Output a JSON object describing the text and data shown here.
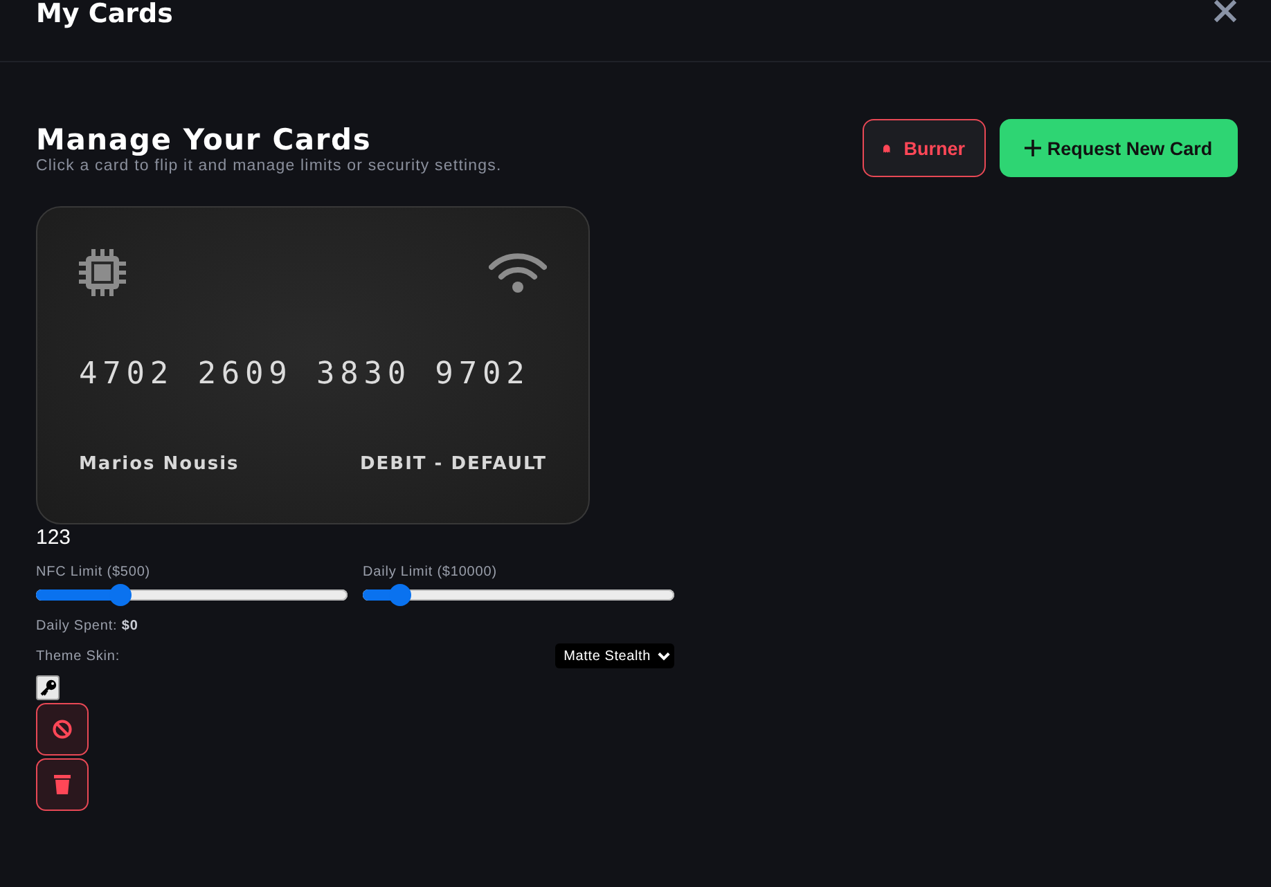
{
  "header": {
    "title": "My Cards"
  },
  "page": {
    "title": "Manage Your Cards",
    "subtitle": "Click a card to flip it and manage limits or security settings."
  },
  "actions": [
    {
      "kind": "burner",
      "label": "Burner"
    },
    {
      "kind": "request",
      "label": "Request New Card"
    }
  ],
  "card": {
    "number": "4702 2609 3830 9702",
    "holder": "Marios Nousis",
    "type": "DEBIT - DEFAULT"
  },
  "cvv": "123",
  "limits": [
    {
      "label": "NFC Limit ($500)",
      "level": 0.27
    },
    {
      "label": "Daily Limit ($10000)",
      "level": 0.12
    }
  ],
  "daily_spent": "Daily Spent: **$0**",
  "theme": {
    "label": "Theme Skin:",
    "value": "Matte Stealth"
  }
}
